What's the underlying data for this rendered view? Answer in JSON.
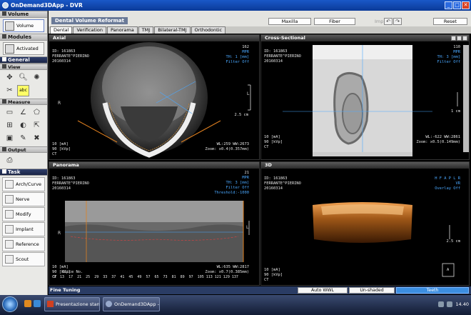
{
  "window": {
    "title": "OnDemand3DApp - DVR"
  },
  "left_panel": {
    "volume": {
      "header": "Volume",
      "button": "Volume"
    },
    "modules": {
      "header": "Modules",
      "button": "Activated"
    },
    "general": {
      "header": "General"
    },
    "view": {
      "header": "View",
      "tools": [
        "move-icon",
        "zoom-icon",
        "brightness-icon",
        "scissors-icon",
        "abc"
      ]
    },
    "measure": {
      "header": "Measure"
    },
    "output": {
      "header": "Output"
    },
    "task": {
      "header": "Task",
      "items": [
        {
          "label": "Arch/Curve"
        },
        {
          "label": "Nerve"
        },
        {
          "label": "Modify"
        },
        {
          "label": "Implant"
        },
        {
          "label": "Reference"
        },
        {
          "label": "Scout"
        }
      ]
    }
  },
  "main_toolbar": {
    "title": "Dental Volume Reformat",
    "maxilla": "Maxilla",
    "fiber": "Fiber",
    "implant_label": "Implant :",
    "reset": "Reset"
  },
  "tabs": [
    "Dental",
    "Verification",
    "Panorama",
    "TMJ",
    "Bilateral-TMJ",
    "Orthodontic"
  ],
  "active_tab": "Dental",
  "viewports": {
    "axial": {
      "title": "Axial",
      "top_left": "ID: 161863\nFERRANTE^PIERINO\n20160314",
      "top_right_num": "162",
      "top_right": "MPR\nTH: 1 [mm]\nFilter Off",
      "bottom_left": "10 [mA]\n90 [kVp]\nCT",
      "bottom_right": "WL:259 WW:2673\nZoom: x0.4(0.357mm)",
      "scale": "2.5 cm",
      "side": "R",
      "side_right": "L"
    },
    "cross": {
      "title": "Cross-Sectional",
      "top_left": "ID: 161863\nFERRANTE^PIERINO\n20160314",
      "top_right_num": "110",
      "top_right": "MPR\nTH: 3 [mm]\nFilter Off",
      "bottom_left": "10 [mA]\n90 [kVp]\nCT",
      "bottom_right": "WL:-622 WW:2861\nZoom: x0.5(0.149mm)",
      "scale": "1 cm"
    },
    "panorama": {
      "title": "Panorama",
      "top_left": "ID: 161863\nFERRANTE^PIERINO\n20160314",
      "top_right_num": "21",
      "top_right": "MPR\nTH: 3 [mm]\nFilter Off\nThreshold:-1000",
      "bottom_left": "10 [mA]\n90 [kVp]\nCT",
      "bottom_right": "WL:635 WW:2817\nZoom: x0.7(0.385mm)",
      "slice_label": "Slice No.",
      "ticks": "9  13  17  21  25  29  33  37  41  45  49  57  65  73  81  89  97  105 113 121 129 137",
      "side": "R",
      "side_right": "L"
    },
    "threed": {
      "title": "3D",
      "top_left": "ID: 161863\nFERRANTE^PIERINO\n20160314",
      "top_right": "H F A P L R\nVR\nOverlay Off",
      "bottom_left": "10 [mA]\n90 [kVp]\nCT",
      "scale": "2.5 cm",
      "orient": "A"
    }
  },
  "status_bar": {
    "fine_tuning": "Fine Tuning",
    "auto_wwl": "Auto WWL",
    "unshaded": "Un-shaded",
    "teeth": "Teeth"
  },
  "taskbar": {
    "items": [
      "Presentazione stan...",
      "OnDemand3DApp - ..."
    ],
    "clock": "14.40"
  }
}
